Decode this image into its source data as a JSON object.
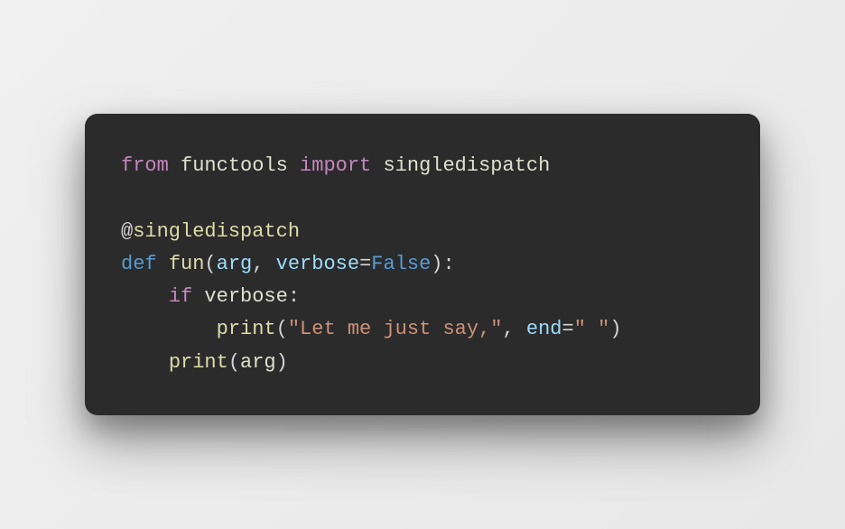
{
  "code": {
    "line1": {
      "from": "from",
      "module": "functools",
      "import": "import",
      "name": "singledispatch"
    },
    "line3": {
      "at": "@",
      "decorator": "singledispatch"
    },
    "line4": {
      "def": "def",
      "fname": "fun",
      "lparen": "(",
      "arg1": "arg",
      "comma": ", ",
      "arg2": "verbose",
      "eq": "=",
      "val": "False",
      "rparen": ")",
      "colon": ":"
    },
    "line5": {
      "indent": "    ",
      "if": "if",
      "cond": "verbose",
      "colon": ":"
    },
    "line6": {
      "indent": "        ",
      "print": "print",
      "lparen": "(",
      "str": "\"Let me just say,\"",
      "comma": ", ",
      "kw": "end",
      "eq": "=",
      "val": "\" \"",
      "rparen": ")"
    },
    "line7": {
      "indent": "    ",
      "print": "print",
      "lparen": "(",
      "arg": "arg",
      "rparen": ")"
    }
  }
}
